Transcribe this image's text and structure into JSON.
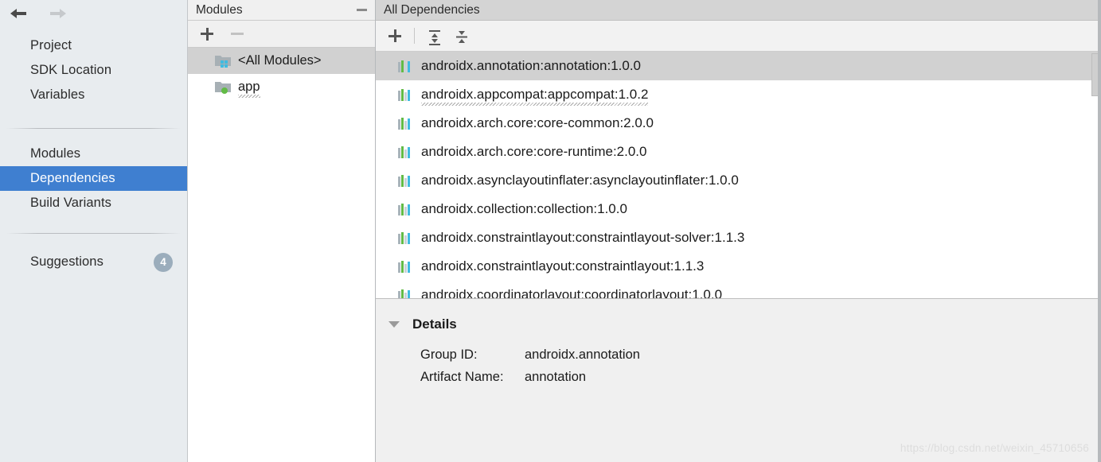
{
  "sidebar": {
    "nav": {
      "back_icon": "arrow-left-icon",
      "forward_icon": "arrow-right-icon"
    },
    "group1": [
      {
        "label": "Project",
        "selected": false
      },
      {
        "label": "SDK Location",
        "selected": false
      },
      {
        "label": "Variables",
        "selected": false
      }
    ],
    "group2": [
      {
        "label": "Modules",
        "selected": false
      },
      {
        "label": "Dependencies",
        "selected": true
      },
      {
        "label": "Build Variants",
        "selected": false
      }
    ],
    "group3": [
      {
        "label": "Suggestions",
        "selected": false,
        "badge": "4"
      }
    ],
    "selection_color": "#3f7fd0",
    "background_color": "#e8ecef",
    "badge_color": "#9badbc"
  },
  "modules_panel": {
    "title": "Modules",
    "minimize_icon": "minimize-icon",
    "toolbar": [
      {
        "name": "add-module-button",
        "icon": "plus-icon",
        "enabled": true
      },
      {
        "name": "remove-module-button",
        "icon": "minus-icon",
        "enabled": false
      }
    ],
    "items": [
      {
        "label": "<All Modules>",
        "icon": "folder-all-modules-icon",
        "selected": true,
        "squiggle": false
      },
      {
        "label": "app",
        "icon": "folder-module-icon",
        "selected": false,
        "squiggle": true
      }
    ]
  },
  "dependencies_panel": {
    "title": "All Dependencies",
    "toolbar": [
      {
        "name": "add-dependency-button",
        "icon": "plus-icon"
      },
      {
        "name": "expand-all-button",
        "icon": "expand-all-icon"
      },
      {
        "name": "collapse-all-button",
        "icon": "collapse-all-icon"
      }
    ],
    "items": [
      {
        "label": "androidx.annotation:annotation:1.0.0",
        "icon": "library-icon",
        "selected": true,
        "squiggle": false
      },
      {
        "label": "androidx.appcompat:appcompat:1.0.2",
        "icon": "library-icon",
        "selected": false,
        "squiggle": true
      },
      {
        "label": "androidx.arch.core:core-common:2.0.0",
        "icon": "library-icon",
        "selected": false,
        "squiggle": false
      },
      {
        "label": "androidx.arch.core:core-runtime:2.0.0",
        "icon": "library-icon",
        "selected": false,
        "squiggle": false
      },
      {
        "label": "androidx.asynclayoutinflater:asynclayoutinflater:1.0.0",
        "icon": "library-icon",
        "selected": false,
        "squiggle": false
      },
      {
        "label": "androidx.collection:collection:1.0.0",
        "icon": "library-icon",
        "selected": false,
        "squiggle": false
      },
      {
        "label": "androidx.constraintlayout:constraintlayout-solver:1.1.3",
        "icon": "library-icon",
        "selected": false,
        "squiggle": false
      },
      {
        "label": "androidx.constraintlayout:constraintlayout:1.1.3",
        "icon": "library-icon",
        "selected": false,
        "squiggle": false
      },
      {
        "label": "androidx.coordinatorlayout:coordinatorlayout:1.0.0",
        "icon": "library-icon",
        "selected": false,
        "squiggle": false
      }
    ],
    "scrollbar": {
      "name": "dependencies-scrollbar"
    }
  },
  "details": {
    "title": "Details",
    "expanded": true,
    "fields": [
      {
        "label": "Group ID:",
        "value": "androidx.annotation"
      },
      {
        "label": "Artifact Name:",
        "value": "annotation"
      }
    ]
  },
  "watermark": {
    "text": "https://blog.csdn.net/weixin_45710656"
  }
}
